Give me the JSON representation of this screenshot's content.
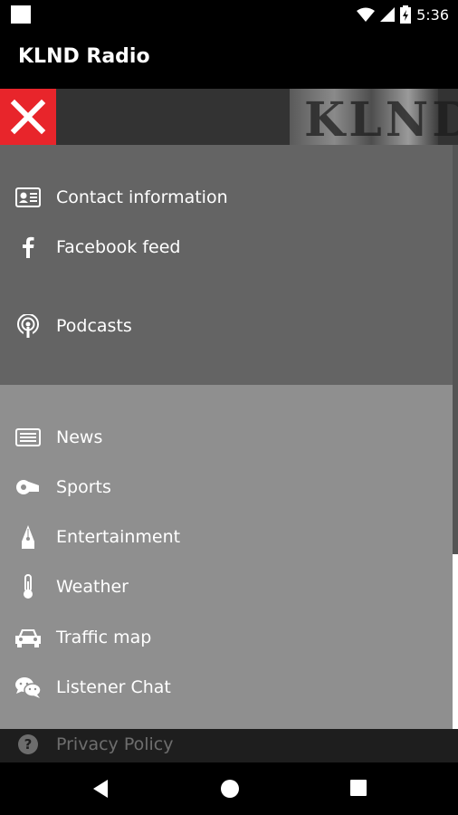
{
  "status_bar": {
    "time": "5:36"
  },
  "app_bar": {
    "title": "KLND Radio"
  },
  "banner": {
    "logo_text": "KLND",
    "accent_color": "#e8252b"
  },
  "menu_dark": [
    {
      "label": "Contact information",
      "icon": "contact-card-icon"
    },
    {
      "label": "Facebook feed",
      "icon": "facebook-icon"
    },
    {
      "label": "Podcasts",
      "icon": "podcast-icon"
    }
  ],
  "menu_light": [
    {
      "label": "News",
      "icon": "newspaper-icon"
    },
    {
      "label": "Sports",
      "icon": "whistle-icon"
    },
    {
      "label": "Entertainment",
      "icon": "pen-nib-icon"
    },
    {
      "label": "Weather",
      "icon": "thermometer-icon"
    },
    {
      "label": "Traffic map",
      "icon": "car-icon"
    },
    {
      "label": "Listener Chat",
      "icon": "chat-icon"
    },
    {
      "label": "Privacy Policy",
      "icon": "help-icon"
    }
  ]
}
